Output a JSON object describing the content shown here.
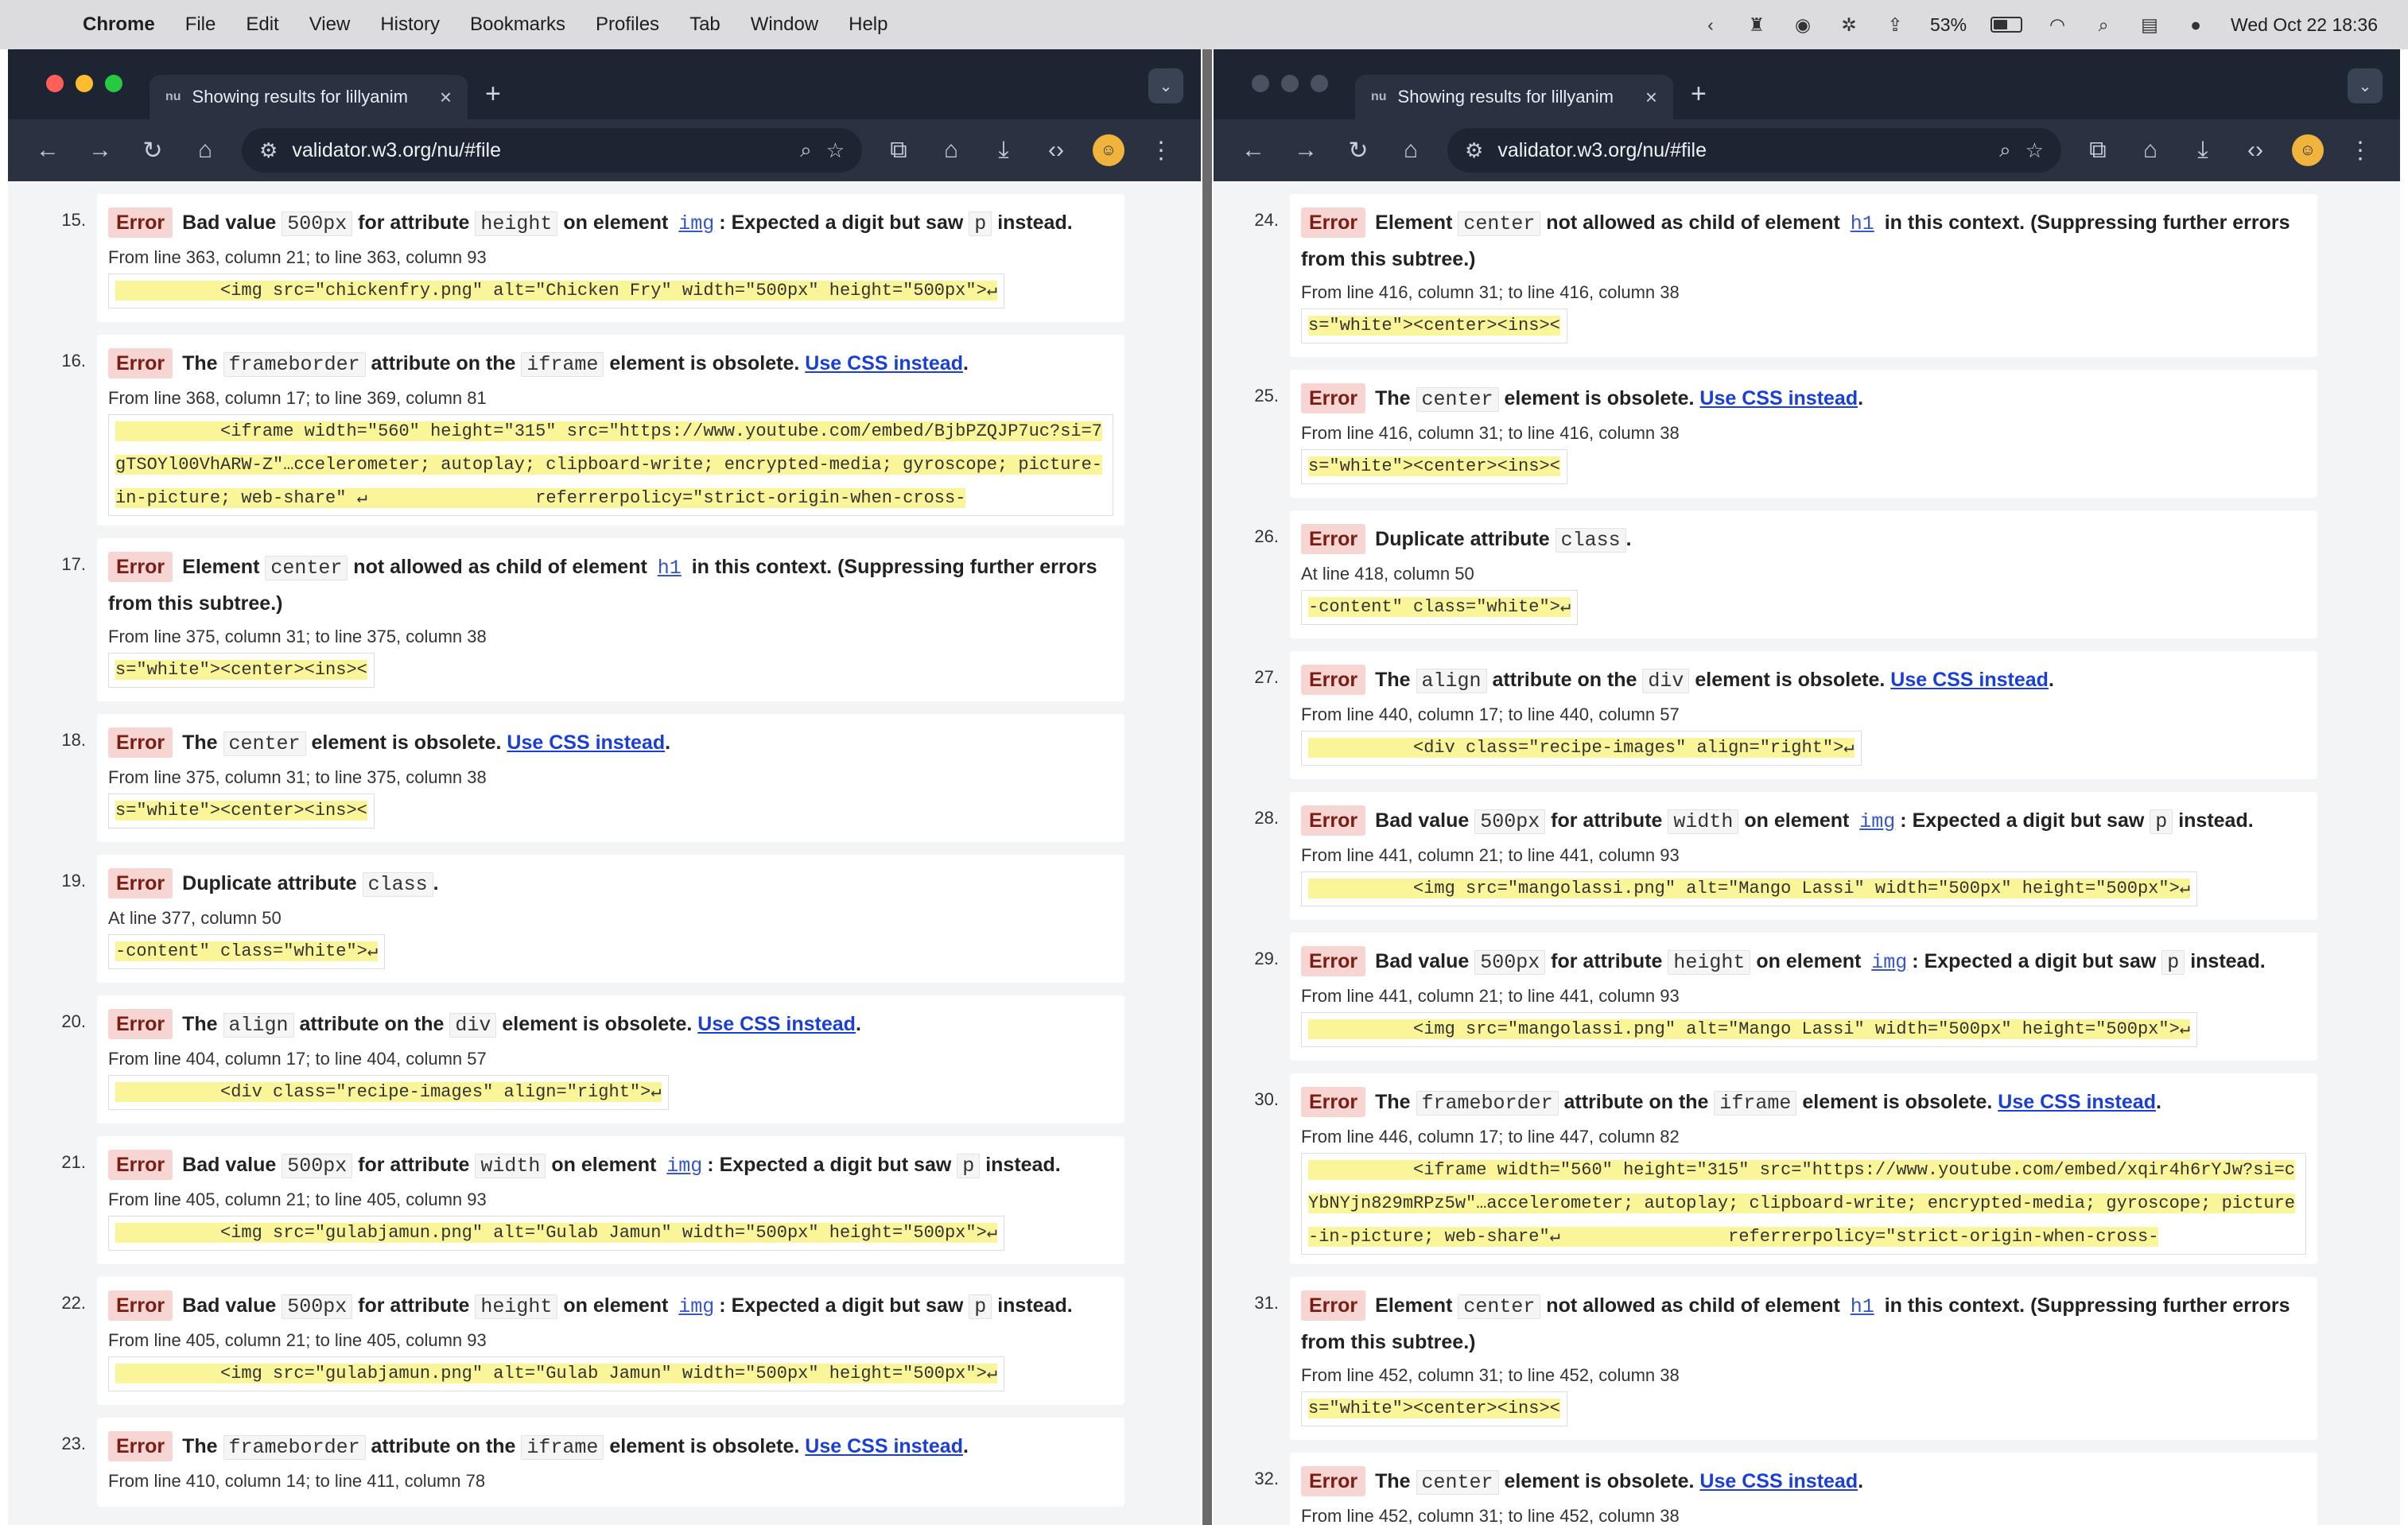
{
  "menubar": {
    "items": [
      "Chrome",
      "File",
      "Edit",
      "View",
      "History",
      "Bookmarks",
      "Profiles",
      "Tab",
      "Window",
      "Help"
    ],
    "battery": "53%",
    "clock": "Wed Oct 22  18:36"
  },
  "left": {
    "tab_title": "Showing results for lillyanim",
    "url": "validator.w3.org/nu/#file",
    "messages": [
      {
        "n": "15.",
        "pre": "Bad value ",
        "c1": "500px",
        "mid1": " for attribute ",
        "c2": "height",
        "mid2": " on element ",
        "c3": "img",
        "post": ": Expected a digit but saw ",
        "c4": "p",
        "tail": " instead.",
        "loc": "From line 363, column 21; to line 363, column 93",
        "ext": "          <img src=\"chickenfry.png\" alt=\"Chicken Fry\" width=\"500px\" height=\"500px\">↵"
      },
      {
        "n": "16.",
        "pre": "The ",
        "c1": "frameborder",
        "mid1": " attribute on the ",
        "c2": "iframe",
        "mid2": " element is obsolete. ",
        "link": "Use CSS instead",
        "tail": ".",
        "loc": "From line 368, column 17; to line 369, column 81",
        "ext": "          <iframe width=\"560\" height=\"315\" src=\"https://www.youtube.com/embed/BjbPZQJP7uc?si=7gTSOYl00VhARW-Z\"…ccelerometer; autoplay; clipboard-write; encrypted-media; gyroscope; picture-in-picture; web-share\" ↵                referrerpolicy=\"strict-origin-when-cross-"
      },
      {
        "n": "17.",
        "pre": "Element ",
        "c1": "center",
        "mid1": " not allowed as child of element ",
        "c2": "h1",
        "tail": " in this context. (Suppressing further errors from this subtree.)",
        "loc": "From line 375, column 31; to line 375, column 38",
        "ext": "s=\"white\"><center><ins><"
      },
      {
        "n": "18.",
        "pre": "The ",
        "c1": "center",
        "mid1": " element is obsolete. ",
        "link": "Use CSS instead",
        "tail": ".",
        "loc": "From line 375, column 31; to line 375, column 38",
        "ext": "s=\"white\"><center><ins><"
      },
      {
        "n": "19.",
        "pre": "Duplicate attribute ",
        "c1": "class",
        "tail": ".",
        "loc": "At line 377, column 50",
        "ext": "-content\" class=\"white\">↵"
      },
      {
        "n": "20.",
        "pre": "The ",
        "c1": "align",
        "mid1": " attribute on the ",
        "c2": "div",
        "mid2": " element is obsolete. ",
        "link": "Use CSS instead",
        "tail": ".",
        "loc": "From line 404, column 17; to line 404, column 57",
        "ext": "          <div class=\"recipe-images\" align=\"right\">↵"
      },
      {
        "n": "21.",
        "pre": "Bad value ",
        "c1": "500px",
        "mid1": " for attribute ",
        "c2": "width",
        "mid2": " on element ",
        "c3": "img",
        "post": ": Expected a digit but saw ",
        "c4": "p",
        "tail": " instead.",
        "loc": "From line 405, column 21; to line 405, column 93",
        "ext": "          <img src=\"gulabjamun.png\" alt=\"Gulab Jamun\" width=\"500px\" height=\"500px\">↵"
      },
      {
        "n": "22.",
        "pre": "Bad value ",
        "c1": "500px",
        "mid1": " for attribute ",
        "c2": "height",
        "mid2": " on element ",
        "c3": "img",
        "post": ": Expected a digit but saw ",
        "c4": "p",
        "tail": " instead.",
        "loc": "From line 405, column 21; to line 405, column 93",
        "ext": "          <img src=\"gulabjamun.png\" alt=\"Gulab Jamun\" width=\"500px\" height=\"500px\">↵"
      },
      {
        "n": "23.",
        "pre": "The ",
        "c1": "frameborder",
        "mid1": " attribute on the ",
        "c2": "iframe",
        "mid2": " element is obsolete. ",
        "link": "Use CSS instead",
        "tail": ".",
        "loc": "From line 410, column 14; to line 411, column 78",
        "ext": ""
      }
    ]
  },
  "right": {
    "tab_title": "Showing results for lillyanim",
    "url": "validator.w3.org/nu/#file",
    "messages": [
      {
        "n": "24.",
        "pre": "Element ",
        "c1": "center",
        "mid1": " not allowed as child of element ",
        "c2": "h1",
        "tail": " in this context. (Suppressing further errors from this subtree.)",
        "loc": "From line 416, column 31; to line 416, column 38",
        "ext": "s=\"white\"><center><ins><"
      },
      {
        "n": "25.",
        "pre": "The ",
        "c1": "center",
        "mid1": " element is obsolete. ",
        "link": "Use CSS instead",
        "tail": ".",
        "loc": "From line 416, column 31; to line 416, column 38",
        "ext": "s=\"white\"><center><ins><"
      },
      {
        "n": "26.",
        "pre": "Duplicate attribute ",
        "c1": "class",
        "tail": ".",
        "loc": "At line 418, column 50",
        "ext": "-content\" class=\"white\">↵"
      },
      {
        "n": "27.",
        "pre": "The ",
        "c1": "align",
        "mid1": " attribute on the ",
        "c2": "div",
        "mid2": " element is obsolete. ",
        "link": "Use CSS instead",
        "tail": ".",
        "loc": "From line 440, column 17; to line 440, column 57",
        "ext": "          <div class=\"recipe-images\" align=\"right\">↵"
      },
      {
        "n": "28.",
        "pre": "Bad value ",
        "c1": "500px",
        "mid1": " for attribute ",
        "c2": "width",
        "mid2": " on element ",
        "c3": "img",
        "post": ": Expected a digit but saw ",
        "c4": "p",
        "tail": " instead.",
        "loc": "From line 441, column 21; to line 441, column 93",
        "ext": "          <img src=\"mangolassi.png\" alt=\"Mango Lassi\" width=\"500px\" height=\"500px\">↵"
      },
      {
        "n": "29.",
        "pre": "Bad value ",
        "c1": "500px",
        "mid1": " for attribute ",
        "c2": "height",
        "mid2": " on element ",
        "c3": "img",
        "post": ": Expected a digit but saw ",
        "c4": "p",
        "tail": " instead.",
        "loc": "From line 441, column 21; to line 441, column 93",
        "ext": "          <img src=\"mangolassi.png\" alt=\"Mango Lassi\" width=\"500px\" height=\"500px\">↵"
      },
      {
        "n": "30.",
        "pre": "The ",
        "c1": "frameborder",
        "mid1": " attribute on the ",
        "c2": "iframe",
        "mid2": " element is obsolete. ",
        "link": "Use CSS instead",
        "tail": ".",
        "loc": "From line 446, column 17; to line 447, column 82",
        "ext": "          <iframe width=\"560\" height=\"315\" src=\"https://www.youtube.com/embed/xqir4h6rYJw?si=cYbNYjn829mRPz5w\"…accelerometer; autoplay; clipboard-write; encrypted-media; gyroscope; picture-in-picture; web-share\"↵                referrerpolicy=\"strict-origin-when-cross-"
      },
      {
        "n": "31.",
        "pre": "Element ",
        "c1": "center",
        "mid1": " not allowed as child of element ",
        "c2": "h1",
        "tail": " in this context. (Suppressing further errors from this subtree.)",
        "loc": "From line 452, column 31; to line 452, column 38",
        "ext": "s=\"white\"><center><ins><"
      },
      {
        "n": "32.",
        "pre": "The ",
        "c1": "center",
        "mid1": " element is obsolete. ",
        "link": "Use CSS instead",
        "tail": ".",
        "loc": "From line 452, column 31; to line 452, column 38",
        "ext": ""
      }
    ]
  },
  "error_label": "Error",
  "colors": {
    "error_badge_bg": "#f6d5d2",
    "error_badge_fg": "#7a1d14",
    "highlight": "#fbf59a",
    "link": "#1a3fd6",
    "chrome_dark": "#2a3242"
  }
}
